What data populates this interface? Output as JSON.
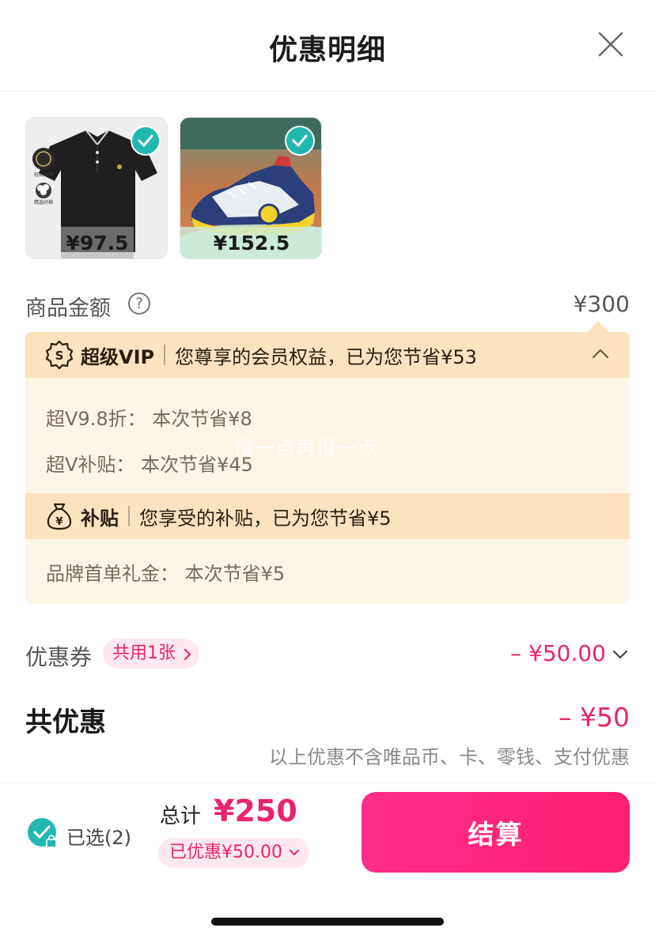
{
  "header": {
    "title": "优惠明细"
  },
  "products": [
    {
      "price": "¥97.5",
      "selected": true,
      "badge_top": "轻商务情",
      "badge_bottom": "精选好棉"
    },
    {
      "price": "¥152.5",
      "selected": true
    }
  ],
  "amount": {
    "label": "商品金额",
    "value": "¥300"
  },
  "vip": {
    "name": "超级VIP",
    "desc": "您尊享的会员权益，已为您节省¥53",
    "lines": [
      "超V9.8折：  本次节省¥8",
      "超V补贴：  本次节省¥45"
    ]
  },
  "subsidy": {
    "name": "补贴",
    "desc": "您享受的补贴，已为您节省¥5",
    "lines": [
      "品牌首单礼金：  本次节省¥5"
    ]
  },
  "watermark": "慢一点再慢一点",
  "coupon": {
    "label": "优惠券",
    "chip": "共用1张",
    "value": "– ¥50.00"
  },
  "total": {
    "label": "共优惠",
    "value": "– ¥50",
    "note": "以上优惠不含唯品币、卡、零钱、支付优惠"
  },
  "bottom": {
    "selected_label": "已选(2)",
    "sum_label": "总计",
    "sum_value": "¥250",
    "saved": "已优惠¥50.00",
    "checkout": "结算"
  },
  "colors": {
    "accent": "#e8246e",
    "check": "#22b8b0",
    "vip_bg": "#fff5e6",
    "vip_head": "#fde2c0"
  }
}
